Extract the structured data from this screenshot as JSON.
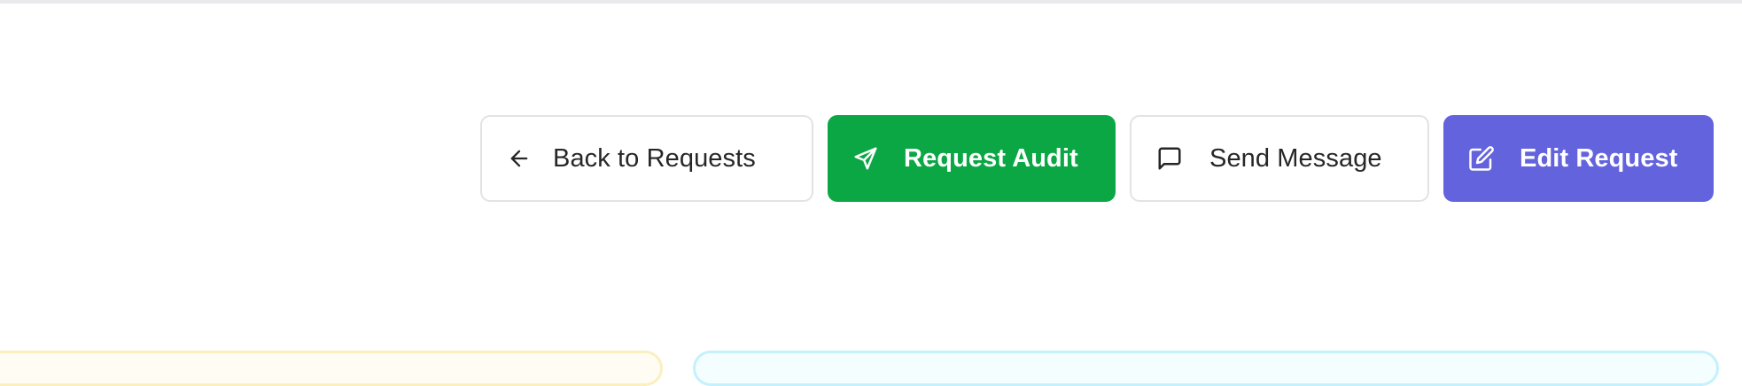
{
  "actions": {
    "back_label": "Back to Requests",
    "audit_label": "Request Audit",
    "message_label": "Send Message",
    "edit_label": "Edit Request"
  },
  "icons": {
    "back": "arrow-left-icon",
    "audit": "send-icon",
    "message": "message-square-icon",
    "edit": "edit-icon"
  },
  "colors": {
    "audit_bg": "#0ca745",
    "edit_bg": "#6463de",
    "outline_border": "#e2e3e6",
    "card_warning_border": "#fbefc0",
    "card_info_border": "#c4f1fb"
  }
}
